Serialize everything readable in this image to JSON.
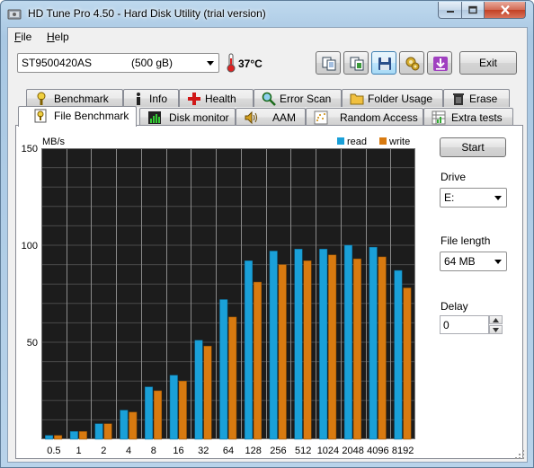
{
  "window": {
    "title": "HD Tune Pro 4.50 - Hard Disk Utility (trial version)"
  },
  "menu": {
    "file_u": "F",
    "file_rest": "ile",
    "help_u": "H",
    "help_rest": "elp"
  },
  "toolbar": {
    "drive_model": "ST9500420AS",
    "drive_size": "(500 gB)",
    "temperature": "37°C",
    "buttons": [
      "copy-text-icon",
      "copy-screenshot-icon",
      "save-icon",
      "options-icon",
      "minimize-to-tray-icon"
    ],
    "exit_label": "Exit"
  },
  "tabs_row1": [
    {
      "label": "Benchmark",
      "icon": "benchmark-icon"
    },
    {
      "label": "Info",
      "icon": "info-icon"
    },
    {
      "label": "Health",
      "icon": "health-icon"
    },
    {
      "label": "Error Scan",
      "icon": "error-scan-icon"
    },
    {
      "label": "Folder Usage",
      "icon": "folder-icon"
    },
    {
      "label": "Erase",
      "icon": "trash-icon"
    }
  ],
  "tabs_row2": [
    {
      "label": "File Benchmark",
      "icon": "file-benchmark-icon",
      "selected": true
    },
    {
      "label": "Disk monitor",
      "icon": "disk-monitor-icon"
    },
    {
      "label": "AAM",
      "icon": "speaker-icon"
    },
    {
      "label": "Random Access",
      "icon": "random-access-icon"
    },
    {
      "label": "Extra tests",
      "icon": "extra-tests-icon"
    }
  ],
  "controls": {
    "start_label": "Start",
    "drive_label": "Drive",
    "drive_value": "E:",
    "file_length_label": "File length",
    "file_length_value": "64 MB",
    "delay_label": "Delay",
    "delay_value": "0"
  },
  "colors": {
    "read": "#1aa0d8",
    "write": "#d87a10",
    "plot_bg": "#1c1c1c"
  },
  "chart_data": {
    "type": "bar",
    "ylabel": "MB/s",
    "ylim": [
      0,
      150
    ],
    "yticks": [
      50,
      100,
      150
    ],
    "categories": [
      "0.5",
      "1",
      "2",
      "4",
      "8",
      "16",
      "32",
      "64",
      "128",
      "256",
      "512",
      "1024",
      "2048",
      "4096",
      "8192"
    ],
    "series": [
      {
        "name": "read",
        "values": [
          2,
          4,
          8,
          15,
          27,
          33,
          51,
          72,
          92,
          97,
          98,
          98,
          100,
          99,
          87
        ]
      },
      {
        "name": "write",
        "values": [
          2,
          4,
          8,
          14,
          25,
          30,
          48,
          63,
          81,
          90,
          92,
          95,
          93,
          94,
          78
        ]
      }
    ],
    "legend": "top-right",
    "grid": true
  }
}
